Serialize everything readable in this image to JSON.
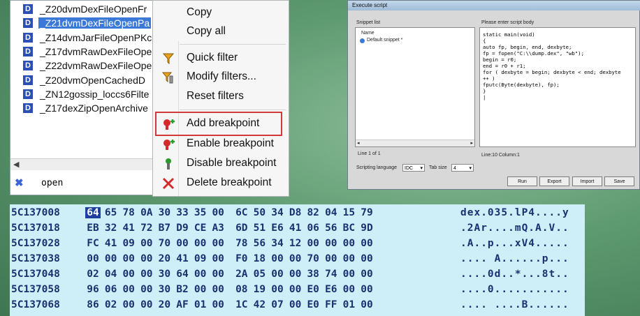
{
  "function_list": {
    "items": [
      {
        "label": "_Z20dvmDexFileOpenFr",
        "selected": false
      },
      {
        "label": "_Z21dvmDexFileOpenPa",
        "selected": true
      },
      {
        "label": "_Z14dvmJarFileOpenPKc",
        "selected": false
      },
      {
        "label": "_Z17dvmRawDexFileOpe",
        "selected": false
      },
      {
        "label": "_Z22dvmRawDexFileOpe",
        "selected": false
      },
      {
        "label": "_Z20dvmOpenCachedD",
        "selected": false
      },
      {
        "label": "_ZN12gossip_loccs6Filte",
        "selected": false
      },
      {
        "label": "_Z17dexZipOpenArchive",
        "selected": false
      }
    ],
    "item_icon": "D",
    "search_value": "open"
  },
  "context_menu": {
    "items": [
      {
        "label": "Copy",
        "icon": ""
      },
      {
        "label": "Copy all",
        "icon": ""
      },
      {
        "label": "Quick filter",
        "icon": "filter-icon"
      },
      {
        "label": "Modify filters...",
        "icon": "filter-edit-icon"
      },
      {
        "label": "Reset filters",
        "icon": ""
      },
      {
        "label": "Add breakpoint",
        "icon": "breakpoint-add-icon"
      },
      {
        "label": "Enable breakpoint",
        "icon": "breakpoint-enable-icon"
      },
      {
        "label": "Disable breakpoint",
        "icon": "breakpoint-disable-icon"
      },
      {
        "label": "Delete breakpoint",
        "icon": "delete-icon"
      }
    ],
    "highlight_color": "#d23a3a"
  },
  "script_window": {
    "title": "Execute script",
    "snippet_list_label": "Snippet list",
    "column_name": "Name",
    "snippet": "Default snippet *",
    "line_status": "Line 1 of 1",
    "body_label": "Please enter script body",
    "code": "static main(void)\n{\nauto fp, begin, end, dexbyte;\nfp = fopen(\"C:\\\\dump.dex\", \"wb\");\nbegin = r0;\nend = r0 + r1;\nfor ( dexbyte = begin; dexbyte < end; dexbyte\n++ )\nfputc(Byte(dexbyte), fp);\n}\n|",
    "cursor_status": "Line:10 Column:1",
    "scripting_language_label": "Scripting language",
    "scripting_language_value": "IDC",
    "tab_size_label": "Tab size",
    "tab_size_value": "4",
    "buttons": [
      "Run",
      "Export",
      "Import",
      "Save"
    ]
  },
  "hex_dump": {
    "rows": [
      {
        "addr": "5C137008",
        "bytes": [
          "64",
          "65",
          "78",
          "0A",
          "30",
          "33",
          "35",
          "00",
          "6C",
          "50",
          "34",
          "D8",
          "82",
          "04",
          "15",
          "79"
        ],
        "ascii": "dex.035.lP4....y"
      },
      {
        "addr": "5C137018",
        "bytes": [
          "EB",
          "32",
          "41",
          "72",
          "B7",
          "D9",
          "CE",
          "A3",
          "6D",
          "51",
          "E6",
          "41",
          "06",
          "56",
          "BC",
          "9D"
        ],
        "ascii": ".2Ar....mQ.A.V.."
      },
      {
        "addr": "5C137028",
        "bytes": [
          "FC",
          "41",
          "09",
          "00",
          "70",
          "00",
          "00",
          "00",
          "78",
          "56",
          "34",
          "12",
          "00",
          "00",
          "00",
          "00"
        ],
        "ascii": ".A..p...xV4....."
      },
      {
        "addr": "5C137038",
        "bytes": [
          "00",
          "00",
          "00",
          "00",
          "20",
          "41",
          "09",
          "00",
          "F0",
          "18",
          "00",
          "00",
          "70",
          "00",
          "00",
          "00"
        ],
        "ascii": ".... A......p..."
      },
      {
        "addr": "5C137048",
        "bytes": [
          "02",
          "04",
          "00",
          "00",
          "30",
          "64",
          "00",
          "00",
          "2A",
          "05",
          "00",
          "00",
          "38",
          "74",
          "00",
          "00"
        ],
        "ascii": "....0d..*...8t.."
      },
      {
        "addr": "5C137058",
        "bytes": [
          "96",
          "06",
          "00",
          "00",
          "30",
          "B2",
          "00",
          "00",
          "08",
          "19",
          "00",
          "00",
          "E0",
          "E6",
          "00",
          "00"
        ],
        "ascii": "....0..........."
      },
      {
        "addr": "5C137068",
        "bytes": [
          "86",
          "02",
          "00",
          "00",
          "20",
          "AF",
          "01",
          "00",
          "1C",
          "42",
          "07",
          "00",
          "E0",
          "FF",
          "01",
          "00"
        ],
        "ascii": ".... ....B......"
      }
    ],
    "cursor_color": "#1d3f9e"
  }
}
